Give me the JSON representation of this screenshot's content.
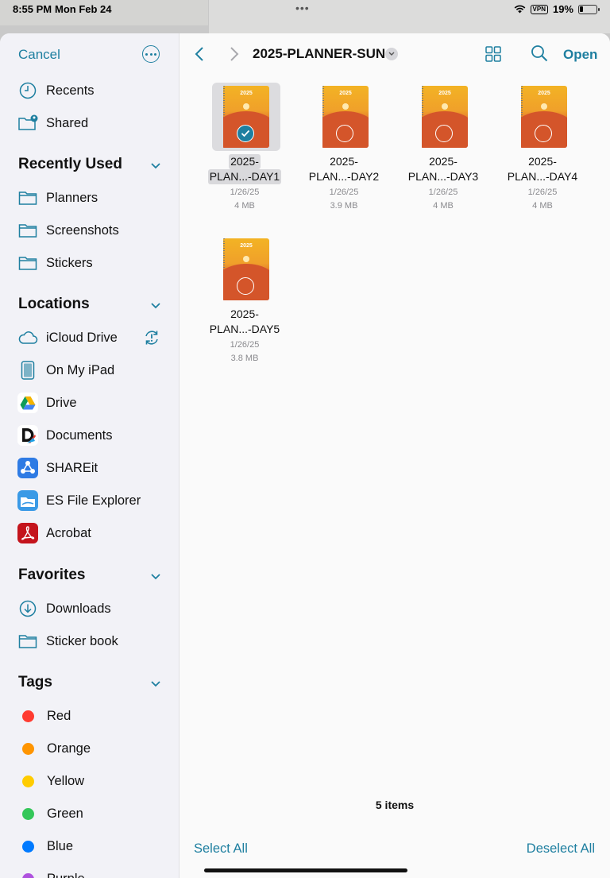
{
  "status_bar": {
    "time": "8:55 PM",
    "date": "Mon Feb 24",
    "vpn": "VPN",
    "battery": "19%"
  },
  "sidebar": {
    "cancel": "Cancel",
    "top_items": [
      {
        "label": "Recents",
        "icon": "clock-icon"
      },
      {
        "label": "Shared",
        "icon": "shared-folder-icon"
      }
    ],
    "recently_used": {
      "title": "Recently Used",
      "items": [
        {
          "label": "Planners",
          "icon": "folder-icon"
        },
        {
          "label": "Screenshots",
          "icon": "folder-icon"
        },
        {
          "label": "Stickers",
          "icon": "folder-icon"
        }
      ]
    },
    "locations": {
      "title": "Locations",
      "items": [
        {
          "label": "iCloud Drive",
          "icon": "cloud-icon"
        },
        {
          "label": "On My iPad",
          "icon": "ipad-icon"
        },
        {
          "label": "Drive",
          "icon": "google-drive-icon"
        },
        {
          "label": "Documents",
          "icon": "documents-app-icon"
        },
        {
          "label": "SHAREit",
          "icon": "shareit-icon"
        },
        {
          "label": "ES File Explorer",
          "icon": "es-file-explorer-icon"
        },
        {
          "label": "Acrobat",
          "icon": "acrobat-icon"
        }
      ]
    },
    "favorites": {
      "title": "Favorites",
      "items": [
        {
          "label": "Downloads",
          "icon": "download-icon"
        },
        {
          "label": "Sticker book",
          "icon": "folder-icon"
        }
      ]
    },
    "tags": {
      "title": "Tags",
      "items": [
        {
          "label": "Red",
          "color": "#ff3b30"
        },
        {
          "label": "Orange",
          "color": "#ff9500"
        },
        {
          "label": "Yellow",
          "color": "#ffcc00"
        },
        {
          "label": "Green",
          "color": "#34c759"
        },
        {
          "label": "Blue",
          "color": "#007aff"
        },
        {
          "label": "Purple",
          "color": "#af52de"
        }
      ]
    }
  },
  "toolbar": {
    "folder_title": "2025-PLANNER-SUN",
    "open": "Open"
  },
  "files": [
    {
      "line1": "2025-",
      "line2": "PLAN...-DAY1",
      "date": "1/26/25",
      "size": "4 MB",
      "selected": true
    },
    {
      "line1": "2025-",
      "line2": "PLAN...-DAY2",
      "date": "1/26/25",
      "size": "3.9 MB",
      "selected": false
    },
    {
      "line1": "2025-",
      "line2": "PLAN...-DAY3",
      "date": "1/26/25",
      "size": "4 MB",
      "selected": false
    },
    {
      "line1": "2025-",
      "line2": "PLAN...-DAY4",
      "date": "1/26/25",
      "size": "4 MB",
      "selected": false
    },
    {
      "line1": "2025-",
      "line2": "PLAN...-DAY5",
      "date": "1/26/25",
      "size": "3.8 MB",
      "selected": false
    }
  ],
  "cover_year": "2025",
  "footer": {
    "item_count": "5 items",
    "select_all": "Select All",
    "deselect_all": "Deselect All"
  },
  "accent_color": "#1e7fa0"
}
